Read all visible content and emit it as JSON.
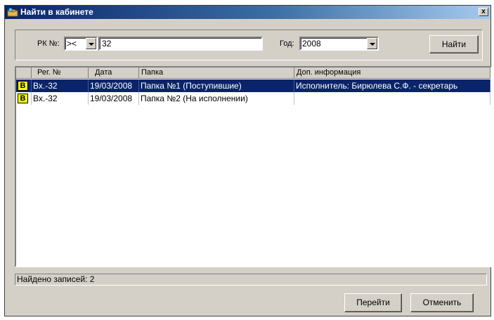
{
  "window": {
    "title": "Найти в кабинете",
    "close_label": "x",
    "icon": "folder-search-icon"
  },
  "search": {
    "rk_label": "РК №:",
    "operator_value": "><",
    "number_value": "32",
    "year_label": "Год:",
    "year_value": "2008",
    "find_label": "Найти"
  },
  "table": {
    "columns": [
      "Рег. №",
      "Дата",
      "Папка",
      "Доп. информация"
    ],
    "rows": [
      {
        "badge": "В",
        "reg": "Вх.-32",
        "date": "19/03/2008",
        "folder": "Папка №1 (Поступившие)",
        "info": "Исполнитель: Бирюлева С.Ф. - секретарь",
        "selected": true
      },
      {
        "badge": "В",
        "reg": "Вх.-32",
        "date": "19/03/2008",
        "folder": "Папка №2 (На исполнении)",
        "info": "",
        "selected": false
      }
    ]
  },
  "status": {
    "text": "Найдено записей: 2"
  },
  "actions": {
    "go_label": "Перейти",
    "cancel_label": "Отменить"
  },
  "colors": {
    "selection": "#0a246a",
    "face": "#d4d0c8",
    "badge": "#ffff00"
  }
}
